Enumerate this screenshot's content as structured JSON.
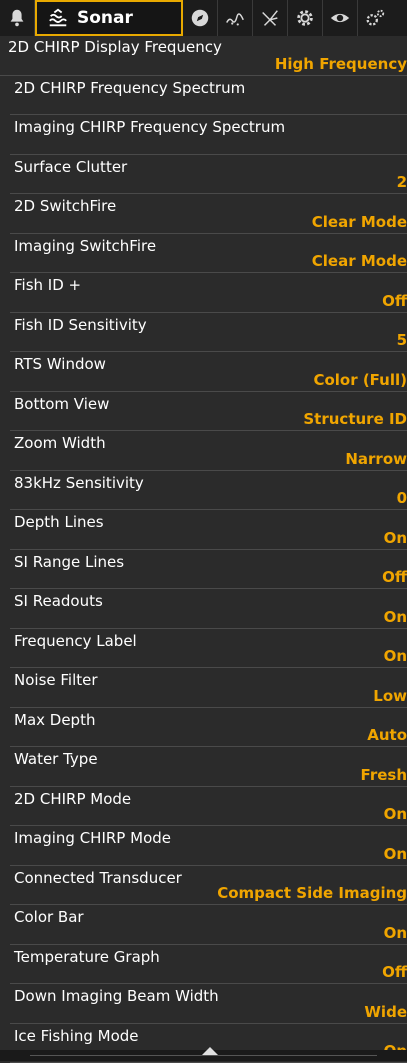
{
  "tabs": {
    "active_label": "Sonar",
    "icons": [
      "bell-icon",
      "sonar-icon",
      "navigation-icon",
      "chart-icon",
      "radar-icon",
      "settings-icon",
      "view-icon",
      "accessories-icon"
    ]
  },
  "colors": {
    "accent": "#f0a500",
    "background": "#2b2b2b"
  },
  "menu": [
    {
      "label": "2D CHIRP Display Frequency",
      "value": "High Frequency"
    },
    {
      "label": "2D CHIRP Frequency Spectrum",
      "value": ""
    },
    {
      "label": "Imaging CHIRP Frequency Spectrum",
      "value": ""
    },
    {
      "label": "Surface Clutter",
      "value": "2"
    },
    {
      "label": "2D SwitchFire",
      "value": "Clear Mode"
    },
    {
      "label": "Imaging SwitchFire",
      "value": "Clear Mode"
    },
    {
      "label": "Fish ID +",
      "value": "Off"
    },
    {
      "label": "Fish ID Sensitivity",
      "value": "5"
    },
    {
      "label": "RTS Window",
      "value": "Color (Full)"
    },
    {
      "label": "Bottom View",
      "value": "Structure ID"
    },
    {
      "label": "Zoom Width",
      "value": "Narrow"
    },
    {
      "label": "83kHz Sensitivity",
      "value": "0"
    },
    {
      "label": "Depth Lines",
      "value": "On"
    },
    {
      "label": "SI Range Lines",
      "value": "Off"
    },
    {
      "label": "SI Readouts",
      "value": "On"
    },
    {
      "label": "Frequency Label",
      "value": "On"
    },
    {
      "label": "Noise Filter",
      "value": "Low"
    },
    {
      "label": "Max Depth",
      "value": "Auto"
    },
    {
      "label": "Water Type",
      "value": "Fresh"
    },
    {
      "label": "2D CHIRP Mode",
      "value": "On"
    },
    {
      "label": "Imaging CHIRP Mode",
      "value": "On"
    },
    {
      "label": "Connected Transducer",
      "value": "Compact Side Imaging"
    },
    {
      "label": "Color Bar",
      "value": "On"
    },
    {
      "label": "Temperature Graph",
      "value": "Off"
    },
    {
      "label": "Down Imaging Beam Width",
      "value": "Wide"
    },
    {
      "label": "Ice Fishing Mode",
      "value": "On"
    }
  ]
}
